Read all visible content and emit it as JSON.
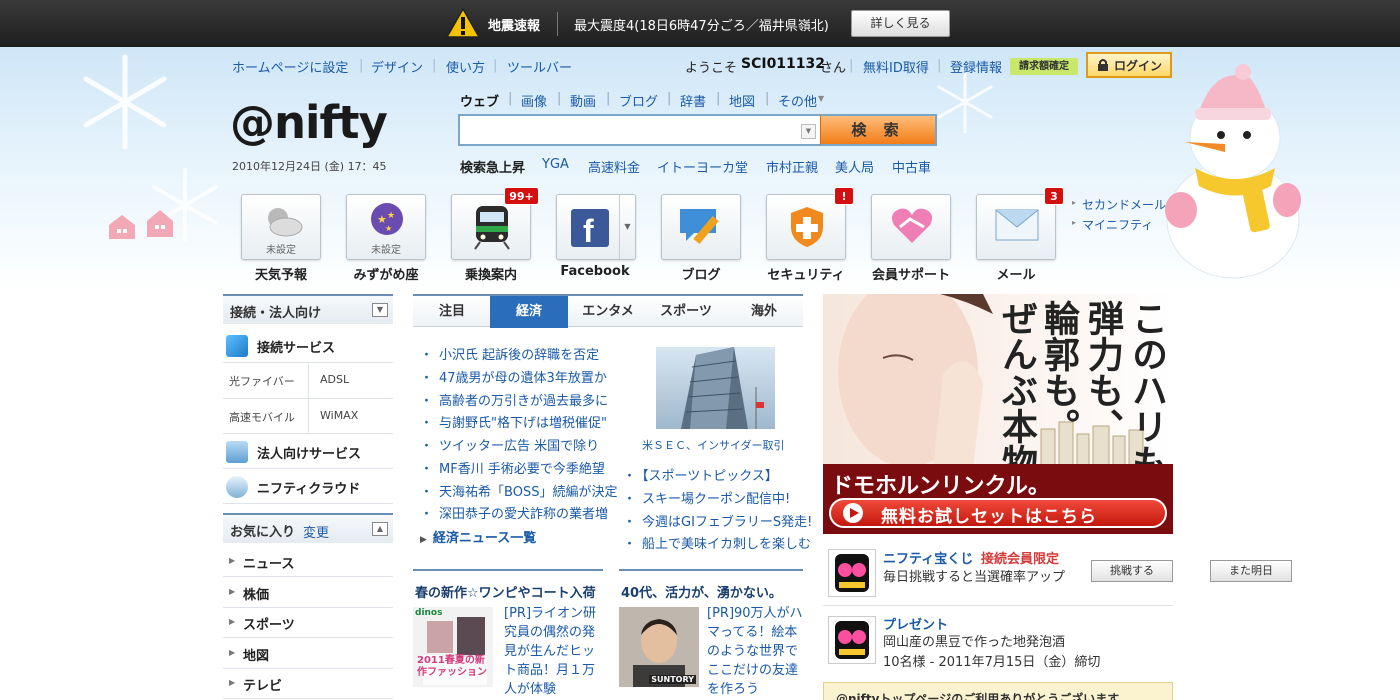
{
  "alert": {
    "title": "地震速報",
    "message": "最大震度4(18日6時47分ごろ／福井県嶺北)",
    "button": "詳しく見る"
  },
  "header": {
    "links": [
      "ホームページに設定",
      "デザイン",
      "使い方",
      "ツールバー"
    ],
    "welcome_prefix": "ようこそ",
    "username": "SCI011132",
    "welcome_suffix": "さん",
    "free_id": "無料ID取得",
    "register_info": "登録情報",
    "billing_badge": "請求額確定",
    "login": "ログイン"
  },
  "logo": "@nifty",
  "datetime": "2010年12月24日 (金) 17：45",
  "search": {
    "tabs": [
      "ウェブ",
      "画像",
      "動画",
      "ブログ",
      "辞書",
      "地図",
      "その他"
    ],
    "active_tab": "ウェブ",
    "value": "",
    "button": "検 索",
    "trend_label": "検索急上昇",
    "trends": [
      "YGA",
      "高速料金",
      "イトーヨーカ堂",
      "市村正親",
      "美人局",
      "中古車"
    ]
  },
  "services": [
    {
      "label": "天気予報",
      "sub": "未設定",
      "icon": "weather-icon",
      "badge": ""
    },
    {
      "label": "みずがめ座",
      "sub": "未設定",
      "icon": "horoscope-icon",
      "badge": ""
    },
    {
      "label": "乗換案内",
      "sub": "",
      "icon": "train-icon",
      "badge": "99+"
    },
    {
      "label": "Facebook",
      "sub": "",
      "icon": "facebook-icon",
      "badge": ""
    },
    {
      "label": "ブログ",
      "sub": "",
      "icon": "blog-icon",
      "badge": ""
    },
    {
      "label": "セキュリティ",
      "sub": "",
      "icon": "security-icon",
      "badge": "!"
    },
    {
      "label": "会員サポート",
      "sub": "",
      "icon": "support-icon",
      "badge": ""
    },
    {
      "label": "メール",
      "sub": "",
      "icon": "mail-icon",
      "badge": "3"
    }
  ],
  "side_links": [
    "セカンドメール",
    "マイニフティ"
  ],
  "left": {
    "connect_head": "接続・法人向け",
    "connect_service": "接続サービス",
    "fiber": "光ファイバー",
    "adsl": "ADSL",
    "mobile": "高速モバイル",
    "wimax": "WiMAX",
    "corp_service": "法人向けサービス",
    "cloud": "ニフティクラウド",
    "fav_head": "お気に入り",
    "fav_edit": "変更",
    "favorites": [
      "ニュース",
      "株価",
      "スポーツ",
      "地図",
      "テレビ"
    ]
  },
  "news": {
    "tabs": [
      "注目",
      "経済",
      "エンタメ",
      "スポーツ",
      "海外"
    ],
    "active_tab": "経済",
    "items": [
      "小沢氏 起訴後の辞職を否定",
      "47歳男が母の遺体3年放置か",
      "高齢者の万引きが過去最多に",
      "与謝野氏\"格下げは増税催促\"",
      "ツイッター広告 米国で除り",
      "MF香川 手術必要で今季絶望",
      "天海祐希「BOSS」続編が決定",
      "深田恭子の愛犬詐称の業者増"
    ],
    "more": "経済ニュース一覧",
    "photo_caption": "米ＳＥＣ、インサイダー取引",
    "side_items": [
      "【スポーツトピックス】",
      "スキー場クーポン配信中!",
      "今週はGIフェブラリーS発走!",
      "船上で美味イカ刺しを楽しむ"
    ]
  },
  "pr": {
    "left_head": "春の新作☆ワンピやコート入荷",
    "left_text": "[PR]ライオン研究員の偶然の発見が生んだヒット商品！月１万人が体験",
    "left_thumb": "2011春夏の新作ファッション",
    "left_thumb_brand": "dinos",
    "right_head": "40代、活力が、湧かない。",
    "right_text": "[PR]90万人がハマってる！絵本のような世界でここだけの友達を作ろう",
    "right_thumb_brand": "SUNTORY"
  },
  "ad": {
    "copy_lines": [
      "このハリも、",
      "弾力も、",
      "輪郭も。",
      "ぜんぶ本物。"
    ],
    "brand": "ドモホルンリンクル。",
    "cta": "無料お試しセットはこちら"
  },
  "promos": [
    {
      "title": "ニフティ宝くじ",
      "tag": "接続会員限定",
      "text": "毎日挑戦すると当選確率アップ",
      "button": "挑戦する",
      "button2": "また明日"
    },
    {
      "title": "プレゼント",
      "text": "岡山産の黒豆で作った地発泡酒",
      "text2": "10名様 - 2011年7月15日（金）締切"
    }
  ],
  "notice": "@niftyトップページのご利用ありがとうございます",
  "colors": {
    "link": "#1a5aa8",
    "accent": "#f27d18",
    "tab_active": "#2a6db8",
    "badge": "#d40f0f"
  }
}
